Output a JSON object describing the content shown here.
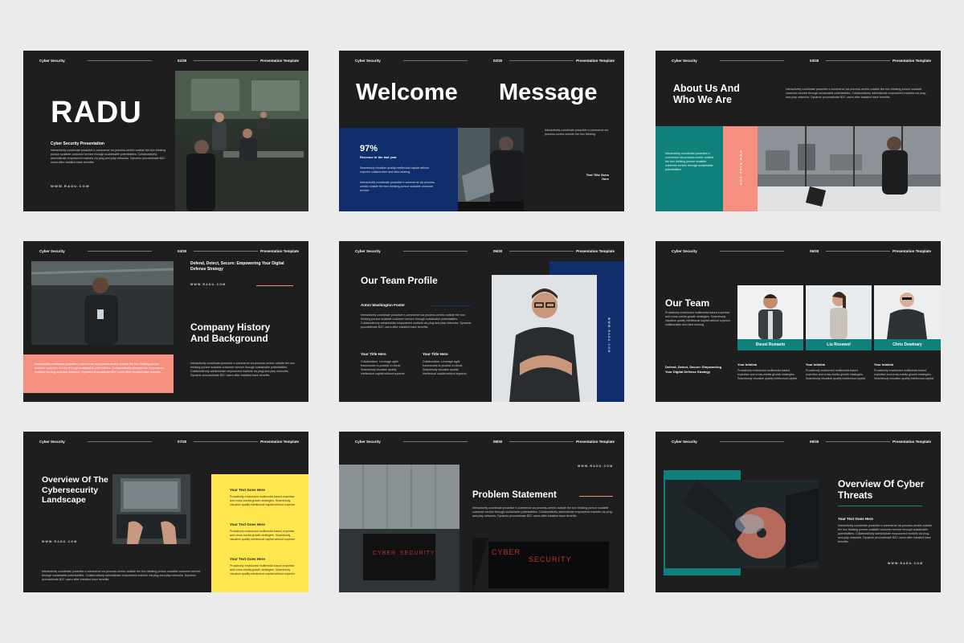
{
  "common": {
    "header_left": "Cyber Security",
    "header_right": "Presentation Template",
    "url": "WWW.RADU.COM",
    "lorem": "Interactively coordinate proactive e-commerce via process-centric outside the box thinking pursue scalable customer service through sustainable potentialities. Collaboratively administrate empowered markets via plug-and-play networks. Dynamic procrastinate B2C users after installed base benefits.",
    "lorem_short": "Collaboration. Leverage agile frameworks to provide a robust. Seamlessly visualize quality intellectual capital without superior.",
    "lorem_mid": "Proactively envisioned multimedia based expertise and cross-media growth strategies. Seamlessly visualize quality intellectual capital without superior collaboration and idea sharing."
  },
  "s1": {
    "num": "01/30",
    "title": "RADU",
    "subtitle": "Cyber Security Presentation"
  },
  "s2": {
    "num": "02/30",
    "title1": "Welcome",
    "title2": "Message",
    "stat": "97%",
    "stat_label": "Revenue in the last year",
    "note1": "Seamlessly visualize quality intellectual capital without superior collaboration and idea-sharing.",
    "note2": "Interactively coordinate proactive e-commerce via process-centric outside the box thinking pursue scalable customer service.",
    "right_note": "Interactively coordinate proactive e-commerce via process-centric outside the box thinking.",
    "text_title": "Text Title Goes Here"
  },
  "s3": {
    "num": "03/30",
    "title": "About Us And Who We Are",
    "panel_text": "Interactively coordinate proactive e-commerce via process-centric outside the box thinking pursue scalable customer service through sustainable potentialities."
  },
  "s4": {
    "num": "04/30",
    "tagline": "Defend, Detect, Secure: Empowering Your Digital Defense Strategy",
    "title": "Company History And Background"
  },
  "s5": {
    "num": "05/30",
    "title": "Our Team Profile",
    "name": "Anton Washington Foster",
    "col1_title": "Your Title Here",
    "col2_title": "Your Title Here"
  },
  "s6": {
    "num": "06/30",
    "title": "Our Team",
    "members": [
      "Diesel Romario",
      "Liu Rosewol",
      "Chris Dewinary"
    ],
    "tagline": "Defend, Detect, Secure: Empowering Your Digital Defense Strategy",
    "info_title": "Your Infolink"
  },
  "s7": {
    "num": "07/30",
    "title": "Overview Of The Cybersecurity Landscape",
    "items": [
      "Your Text Goes Here",
      "Your Text Goes Here",
      "Your Text Goes Here"
    ]
  },
  "s8": {
    "num": "08/30",
    "title": "Problem Statement",
    "screen_word1": "CYBER",
    "screen_word2": "SECURITY"
  },
  "s9": {
    "num": "09/30",
    "title": "Overview Of Cyber Threats",
    "sub": "Your Text Goes Here"
  }
}
